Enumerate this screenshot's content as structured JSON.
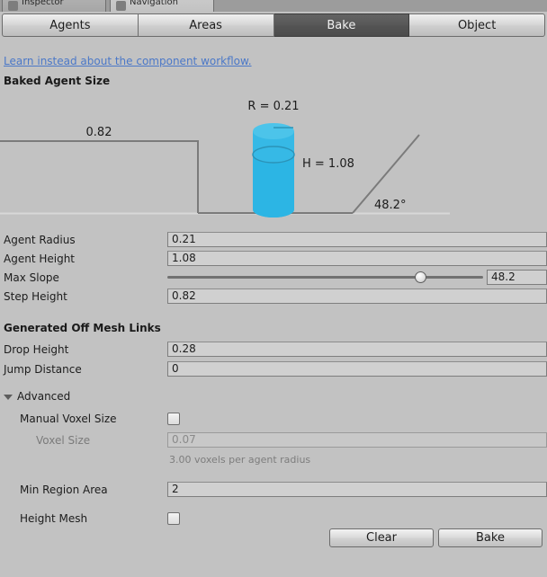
{
  "window": {
    "tabs": [
      {
        "label": "Inspector",
        "icon": "inspector-icon",
        "active": false
      },
      {
        "label": "Navigation",
        "icon": "navigation-icon",
        "active": true
      }
    ]
  },
  "mode_toolbar": {
    "tabs": [
      {
        "label": "Agents",
        "selected": false
      },
      {
        "label": "Areas",
        "selected": false
      },
      {
        "label": "Bake",
        "selected": true
      },
      {
        "label": "Object",
        "selected": false
      }
    ]
  },
  "link": {
    "label": "Learn instead about the component workflow.",
    "color": "#4b78c8"
  },
  "sections": {
    "baked_agent_size": "Baked Agent Size",
    "generated_off_mesh_links": "Generated Off Mesh Links",
    "advanced": "Advanced"
  },
  "diagram": {
    "radius_label": "R = 0.21",
    "height_label": "H = 1.08",
    "step_label": "0.82",
    "slope_label": "48.2°",
    "cylinder_color": "#2cb5e4",
    "cylinder_top_color": "#4cc4ea",
    "line_color": "#7b7b7b",
    "ground_color": "#d8d8d8"
  },
  "fields": {
    "agent_radius": {
      "label": "Agent Radius",
      "value": "0.21"
    },
    "agent_height": {
      "label": "Agent Height",
      "value": "1.08"
    },
    "max_slope": {
      "label": "Max Slope",
      "value": "48.2",
      "slider_percent": 80
    },
    "step_height": {
      "label": "Step Height",
      "value": "0.82"
    },
    "drop_height": {
      "label": "Drop Height",
      "value": "0.28"
    },
    "jump_distance": {
      "label": "Jump Distance",
      "value": "0"
    },
    "manual_voxel_size": {
      "label": "Manual Voxel Size",
      "checked": false
    },
    "voxel_size": {
      "label": "Voxel Size",
      "value": "0.07",
      "disabled": true
    },
    "voxel_hint": "3.00 voxels per agent radius",
    "min_region_area": {
      "label": "Min Region Area",
      "value": "2"
    },
    "height_mesh": {
      "label": "Height Mesh",
      "checked": false
    }
  },
  "buttons": {
    "clear": "Clear",
    "bake": "Bake"
  }
}
